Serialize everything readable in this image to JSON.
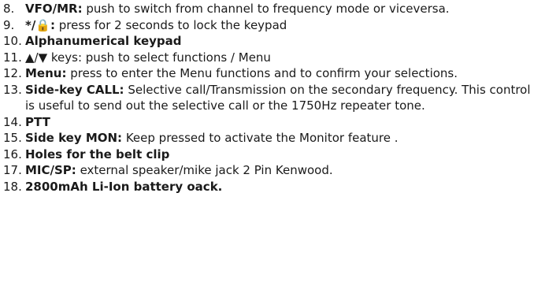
{
  "items": [
    {
      "num": "8.",
      "term": "VFO/MR:",
      "text": " push to switch from channel to frequency mode or viceversa."
    },
    {
      "num": "9.",
      "term": "*/🔒:",
      "text": " press for 2 seconds to lock the keypad"
    },
    {
      "num": "10.",
      "term": "Alphanumerical keypad",
      "text": ""
    },
    {
      "num": "11.",
      "term": "",
      "text": "▲/▼ keys: push to select functions / Menu"
    },
    {
      "num": "12.",
      "term": "Menu:",
      "text": " press to enter the Menu functions and to confirm your selections."
    },
    {
      "num": "13.",
      "term": "Side-key CALL:",
      "text": " Selective call/Transmission on the secondary frequency. This control is useful to send out the selective call or the 1750Hz repeater tone."
    },
    {
      "num": "14.",
      "term": "PTT",
      "text": ""
    },
    {
      "num": "15.",
      "term": "Side key MON:",
      "text": " Keep pressed to activate the Monitor feature ."
    },
    {
      "num": "16.",
      "term": "Holes for the belt clip",
      "text": ""
    },
    {
      "num": "17.",
      "term": "MIC/SP:",
      "text": " external speaker/mike jack 2 Pin Kenwood."
    },
    {
      "num": "18.",
      "term": "2800mAh Li-Ion battery oack.",
      "text": ""
    }
  ]
}
